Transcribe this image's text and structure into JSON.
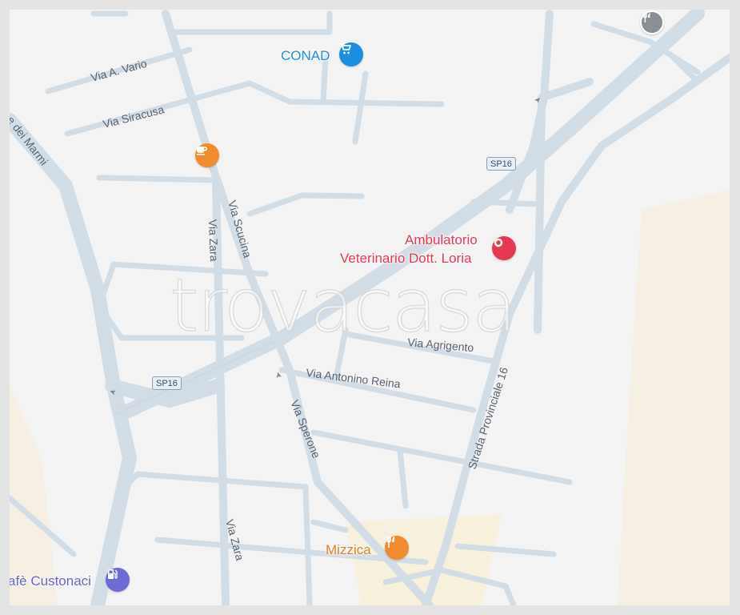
{
  "watermark": "trovacasa",
  "highway": {
    "shield_1": "SP16",
    "shield_2": "SP16"
  },
  "streets": {
    "via_a_vario": "Via A. Vario",
    "via_siracusa": "Via Siracusa",
    "dei_marmi": "e dei Marmi",
    "via_scucina": "Via Scucina",
    "via_zara_top": "Via Zara",
    "via_zara_bottom": "Via Zara",
    "via_agrigento": "Via Agrigento",
    "via_antonino_reina": "Via Antonino Reina",
    "via_sperone": "Via Sperone",
    "strada_provinciale": "Strada Provinciale 16"
  },
  "pois": {
    "conad": {
      "label": "CONAD",
      "icon": "shopping-cart-icon",
      "color": "#1a8fe3"
    },
    "vet": {
      "label_line1": "Ambulatorio",
      "label_line2": "Veterinario Dott. Loria",
      "icon": "location-pin-icon",
      "color": "#e63950"
    },
    "mizzica": {
      "label": "Mizzica",
      "icon": "fork-knife-icon",
      "color": "#f08c2d"
    },
    "cafe": {
      "label": "afè Custonaci",
      "icon": "fuel-icon",
      "color": "#6f6bd6"
    },
    "coffee": {
      "icon": "coffee-cup-icon",
      "color": "#f08c2d"
    },
    "restaurant_top": {
      "icon": "fork-knife-icon",
      "color": "#8a8f96"
    }
  }
}
